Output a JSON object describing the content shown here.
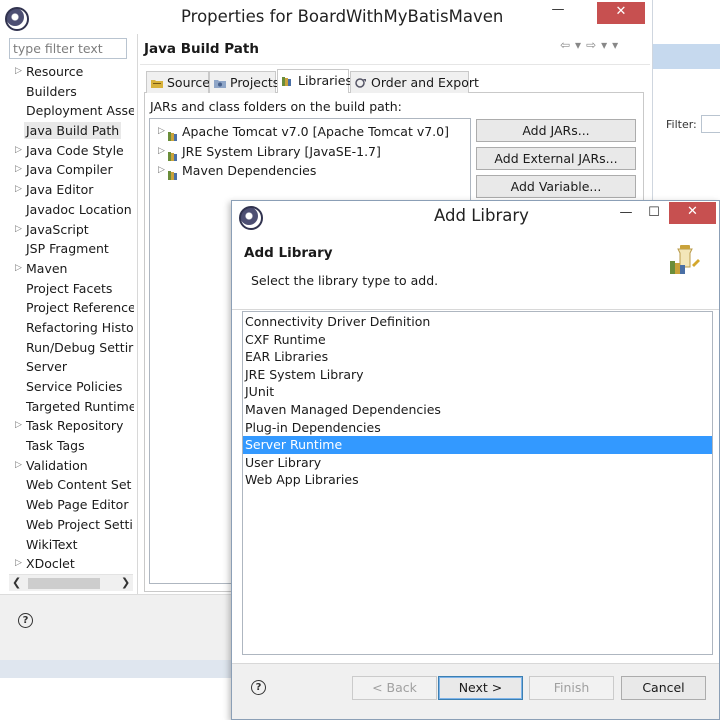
{
  "props_window": {
    "title": "Properties for BoardWithMyBatisMaven",
    "filter_placeholder": "type filter text",
    "nav": [
      {
        "label": "Resource",
        "expandable": true
      },
      {
        "label": "Builders",
        "expandable": false
      },
      {
        "label": "Deployment Asse",
        "expandable": false
      },
      {
        "label": "Java Build Path",
        "expandable": false,
        "selected": true
      },
      {
        "label": "Java Code Style",
        "expandable": true
      },
      {
        "label": "Java Compiler",
        "expandable": true
      },
      {
        "label": "Java Editor",
        "expandable": true
      },
      {
        "label": "Javadoc Location",
        "expandable": false
      },
      {
        "label": "JavaScript",
        "expandable": true
      },
      {
        "label": "JSP Fragment",
        "expandable": false
      },
      {
        "label": "Maven",
        "expandable": true
      },
      {
        "label": "Project Facets",
        "expandable": false
      },
      {
        "label": "Project Reference",
        "expandable": false
      },
      {
        "label": "Refactoring Histo",
        "expandable": false
      },
      {
        "label": "Run/Debug Settir",
        "expandable": false
      },
      {
        "label": "Server",
        "expandable": false
      },
      {
        "label": "Service Policies",
        "expandable": false
      },
      {
        "label": "Targeted Runtime",
        "expandable": false
      },
      {
        "label": "Task Repository",
        "expandable": true
      },
      {
        "label": "Task Tags",
        "expandable": false
      },
      {
        "label": "Validation",
        "expandable": true
      },
      {
        "label": "Web Content Set",
        "expandable": false
      },
      {
        "label": "Web Page Editor",
        "expandable": false
      },
      {
        "label": "Web Project Setti",
        "expandable": false
      },
      {
        "label": "WikiText",
        "expandable": false
      },
      {
        "label": "XDoclet",
        "expandable": true
      }
    ],
    "page_title": "Java Build Path",
    "tabs": [
      "Source",
      "Projects",
      "Libraries",
      "Order and Export"
    ],
    "active_tab": "Libraries",
    "panel_label": "JARs and class folders on the build path:",
    "libraries": [
      "Apache Tomcat v7.0 [Apache Tomcat v7.0]",
      "JRE System Library [JavaSE-1.7]",
      "Maven Dependencies"
    ],
    "buttons": [
      "Add JARs...",
      "Add External JARs...",
      "Add Variable..."
    ],
    "bg_filter_label": "Filter:"
  },
  "dialog": {
    "title": "Add Library",
    "header_title": "Add Library",
    "header_desc": "Select the library type to add.",
    "types": [
      "Connectivity Driver Definition",
      "CXF Runtime",
      "EAR Libraries",
      "JRE System Library",
      "JUnit",
      "Maven Managed Dependencies",
      "Plug-in Dependencies",
      "Server Runtime",
      "User Library",
      "Web App Libraries"
    ],
    "selected_type": "Server Runtime",
    "buttons": {
      "back": "< Back",
      "next": "Next >",
      "finish": "Finish",
      "cancel": "Cancel"
    }
  },
  "colors": {
    "selection": "#3399ff",
    "close_button": "#c75050",
    "background_window_bar": "#c6d9ee"
  },
  "icons": {
    "app": "eclipse-icon",
    "close": "close-icon",
    "minimize": "minimize-icon",
    "maximize": "maximize-icon",
    "help": "help-icon",
    "library": "library-jar-icon",
    "wizard": "library-wizard-icon"
  }
}
